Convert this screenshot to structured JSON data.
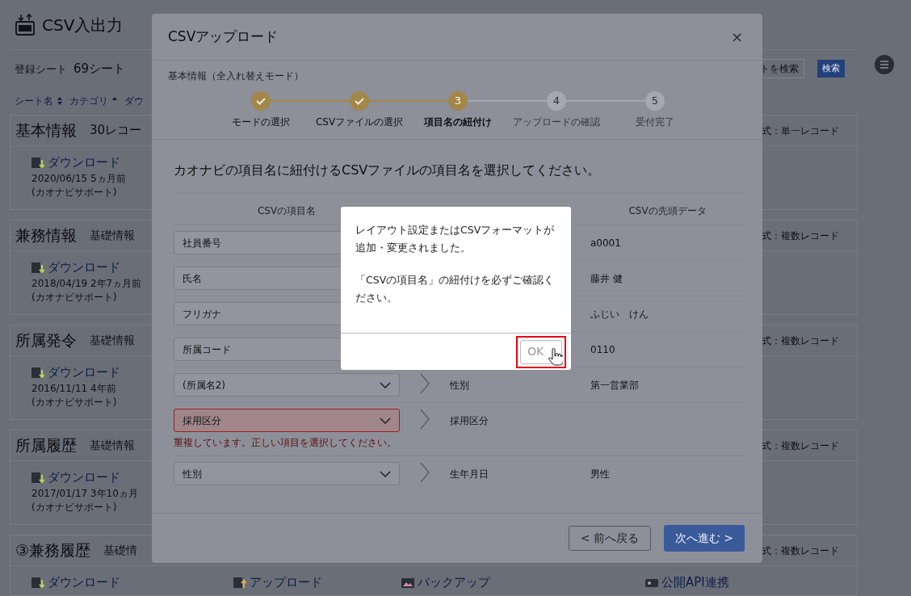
{
  "page": {
    "title": "CSV入出力",
    "count_label": "登録シート",
    "count": "69シート",
    "search": {
      "placeholder": "トを検索"
    },
    "search_button": "検索",
    "sort_columns": [
      {
        "label": "シート名",
        "sorted": false
      },
      {
        "label": "カテゴリ",
        "sorted": true
      },
      {
        "label": "ダウ"
      }
    ],
    "sheets": [
      {
        "title": "基本情報",
        "tag": {
          "kind": "count",
          "text": "30レコー"
        },
        "format": "式：単一レコード",
        "actions": [
          {
            "kind": "download",
            "label": "ダウンロード",
            "date": "2020/06/15 5ヵ月前",
            "author": "(カオナビサポート)"
          }
        ]
      },
      {
        "title": "兼務情報",
        "tag": {
          "kind": "category",
          "text": "基礎情報"
        },
        "format": "式：複数レコード",
        "actions": [
          {
            "kind": "download",
            "label": "ダウンロード",
            "date": "2018/04/19 2年7ヵ月前",
            "author": "(カオナビサポート)"
          }
        ]
      },
      {
        "title": "所属発令",
        "tag": {
          "kind": "category",
          "text": "基礎情報"
        },
        "format": "式：複数レコード",
        "actions": [
          {
            "kind": "download",
            "label": "ダウンロード",
            "date": "2016/11/11 4年前",
            "author": "(カオナビサポート)"
          }
        ]
      },
      {
        "title": "所属履歴",
        "tag": {
          "kind": "category",
          "text": "基礎情報"
        },
        "format": "式：複数レコード",
        "actions": [
          {
            "kind": "download",
            "label": "ダウンロード",
            "date": "2017/01/17 3年10ヵ月",
            "author": "(カオナビサポート)"
          }
        ]
      },
      {
        "title": "③兼務履歴",
        "tag": {
          "kind": "category",
          "text": "基礎情"
        },
        "format": "式：複数レコード",
        "actions": [
          {
            "kind": "download",
            "label": "ダウンロード"
          },
          {
            "kind": "upload",
            "label": "アップロード"
          },
          {
            "kind": "backup",
            "label": "バックアップ"
          },
          {
            "kind": "api",
            "label": "公開API連携"
          }
        ]
      }
    ]
  },
  "modal": {
    "title": "CSVアップロード",
    "close": "×",
    "mode": "基本情報（全入れ替えモード）",
    "steps": [
      {
        "label": "モードの選択",
        "done": true,
        "current": false
      },
      {
        "label": "CSVファイルの選択",
        "done": true,
        "current": false
      },
      {
        "label": "項目名の紐付け",
        "done": false,
        "current": true,
        "number": "3"
      },
      {
        "label": "アップロードの確認",
        "done": false,
        "current": false,
        "number": "4"
      },
      {
        "label": "受付完了",
        "done": false,
        "current": false,
        "number": "5"
      }
    ],
    "instruction": "カオナビの項目名に紐付けるCSVファイルの項目名を選択してください。",
    "column_headers": {
      "csv": "CSVの項目名",
      "sample": "CSVの先頭データ"
    },
    "rows": [
      {
        "csv_field": "社員番号",
        "error": false,
        "sample": "a0001"
      },
      {
        "csv_field": "氏名",
        "error": false,
        "sample": "藤井 健"
      },
      {
        "csv_field": "フリガナ",
        "error": false,
        "sample": "ふじい　けん"
      },
      {
        "csv_field": "所属コード",
        "error": false,
        "sample": "0110"
      },
      {
        "csv_field": "(所属名2)",
        "error": false,
        "item": "性別",
        "sample": "第一営業部"
      },
      {
        "csv_field": "採用区分",
        "error": true,
        "error_message": "重複しています。正しい項目を選択してください。",
        "item": "採用区分"
      },
      {
        "csv_field": "性別",
        "error": false,
        "item": "生年月日",
        "sample": "男性"
      }
    ],
    "back_button": "< 前へ戻る",
    "next_button": "次へ進む >"
  },
  "dialog": {
    "paragraphs": [
      "レイアウト設定またはCSVフォーマットが追加・変更されました。",
      "「CSVの項目名」の紐付けを必ずご確認ください。"
    ],
    "ok_button": {
      "label": "OK",
      "disabled": true,
      "highlighted": true
    }
  }
}
